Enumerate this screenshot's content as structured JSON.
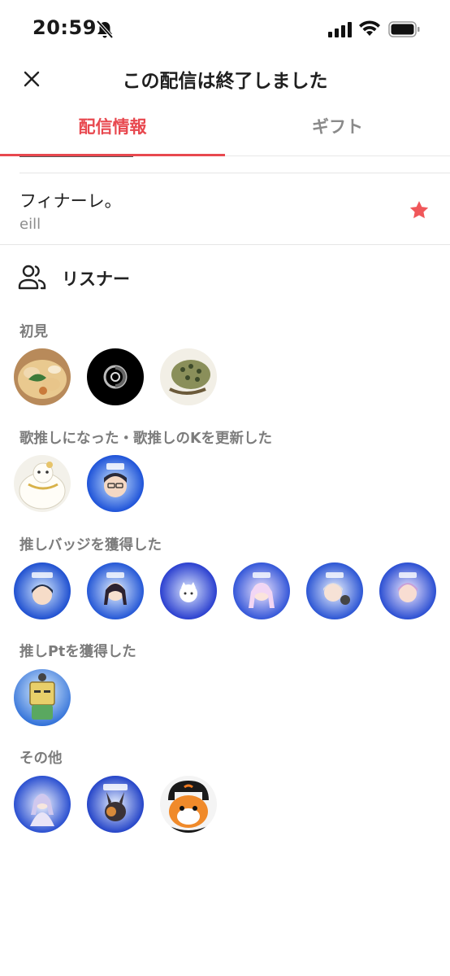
{
  "status_bar": {
    "time": "20:59"
  },
  "nav": {
    "title": "この配信は終了しました"
  },
  "tabs": [
    {
      "label": "配信情報",
      "active": true
    },
    {
      "label": "ギフト",
      "active": false
    }
  ],
  "song": {
    "title": "フィナーレ。",
    "artist": "eill",
    "favorited": true
  },
  "listeners": {
    "heading": "リスナー",
    "sections": [
      {
        "label": "初見",
        "avatar_count": 3
      },
      {
        "label": "歌推しになった・歌推しのKを更新した",
        "avatar_count": 2
      },
      {
        "label": "推しバッジを獲得した",
        "avatar_count": 6
      },
      {
        "label": "推しPtを獲得した",
        "avatar_count": 1
      },
      {
        "label": "その他",
        "avatar_count": 3
      }
    ]
  },
  "colors": {
    "accent": "#e8484f",
    "star": "#f0575a",
    "muted_text": "#7c7c7c"
  }
}
